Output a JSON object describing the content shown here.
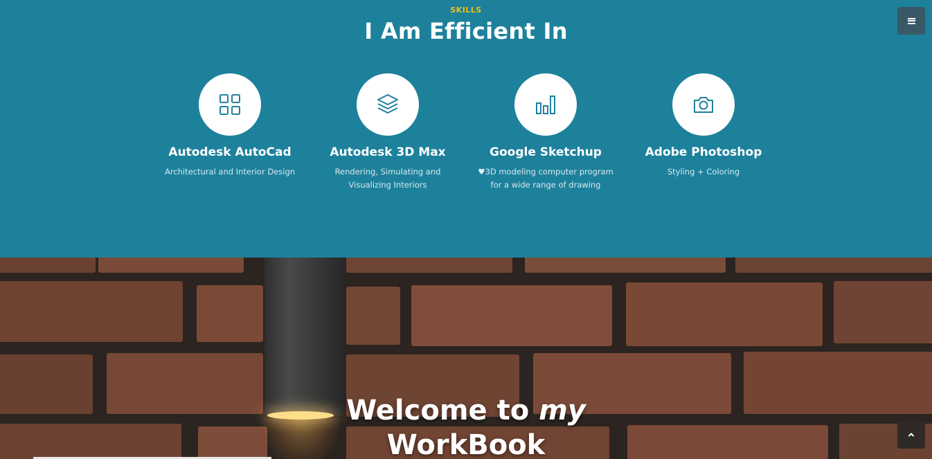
{
  "skills_section": {
    "eyebrow": "SKILLS",
    "title": "I Am Efficient In",
    "items": [
      {
        "name": "Autodesk AutoCad",
        "description": "Architectural and Interior Design",
        "icon": "grid-icon"
      },
      {
        "name": "Autodesk 3D Max",
        "description": "Rendering, Simulating and Visualizing Interiors",
        "icon": "layers-icon"
      },
      {
        "name": "Google Sketchup",
        "description": "3D modeling computer program for a wide range of drawing",
        "description_prefix_icon": "heart-icon",
        "icon": "bar-chart-icon"
      },
      {
        "name": "Adobe Photoshop",
        "description": "Styling + Coloring",
        "icon": "camera-icon"
      }
    ]
  },
  "menu_button": {
    "icon": "hamburger-icon"
  },
  "hero": {
    "title_line1_plain": "Welcome to",
    "title_line1_em": "my",
    "title_line2": "WorkBook"
  },
  "scroll_top_button": {
    "icon": "chevron-up-icon"
  },
  "colors": {
    "section_bg": "#1d819c",
    "eyebrow": "#f2c20e",
    "icon_stroke": "#1d819c",
    "menu_bg": "#3b5866"
  }
}
